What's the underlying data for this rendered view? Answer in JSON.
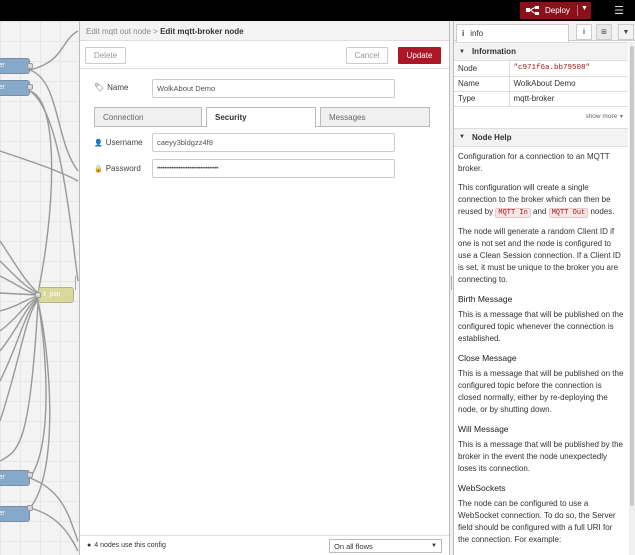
{
  "header": {
    "deploy_label": "Deploy",
    "menu_icon": "hamburger-icon"
  },
  "workspace": {
    "nodes": [
      {
        "label": "ttler"
      },
      {
        "label": "ttler"
      },
      {
        "label": "join"
      },
      {
        "label": "ttler"
      },
      {
        "label": "ttler"
      }
    ]
  },
  "editor": {
    "breadcrumb_parent": "Edit mqtt out node",
    "breadcrumb_sep": ">",
    "breadcrumb_current": "Edit mqtt-broker node",
    "delete_label": "Delete",
    "cancel_label": "Cancel",
    "update_label": "Update",
    "name_label": "Name",
    "name_value": "WolkAbout Demo",
    "tabs": [
      {
        "label": "Connection"
      },
      {
        "label": "Security"
      },
      {
        "label": "Messages"
      }
    ],
    "username_label": "Username",
    "username_value": "caeyy3bldgzz4f8",
    "password_label": "Password",
    "password_value": "••••••••••••••••••••••••••••••••••",
    "footer_note": "4 nodes use this config",
    "scope_value": "On all flows"
  },
  "sidebar": {
    "tab_label": "info",
    "information_title": "Information",
    "info_rows": [
      {
        "key": "Node",
        "value": "\"c971f6a.bb79508\""
      },
      {
        "key": "Name",
        "value": "WolkAbout Demo"
      },
      {
        "key": "Type",
        "value": "mqtt-broker"
      }
    ],
    "show_more": "show more",
    "help_title": "Node Help",
    "help": {
      "p1": "Configuration for a connection to an MQTT broker.",
      "p2_a": "This configuration will create a single connection to the broker which can then be reused by",
      "p2_code1": "MQTT In",
      "p2_and": "and",
      "p2_code2": "MQTT Out",
      "p2_b": "nodes.",
      "p3": "The node will generate a random Client ID if one is not set and the node is configured to use a Clean Session connection. If a Client ID is set, it must be unique to the broker you are connecting to.",
      "h_birth": "Birth Message",
      "p_birth": "This is a message that will be published on the configured topic whenever the connection is established.",
      "h_close": "Close Message",
      "p_close": "This is a message that will be published on the configured topic before the connection is closed normally, either by re-deploying the node, or by shutting down.",
      "h_will": "Will Message",
      "p_will": "This is a message that will be published by the broker in the event the node unexpectedly loses its connection.",
      "h_ws": "WebSockets",
      "p_ws": "The node can be configured to use a WebSocket connection. To do so, the Server field should be configured with a full URI for the connection. For example:"
    }
  }
}
